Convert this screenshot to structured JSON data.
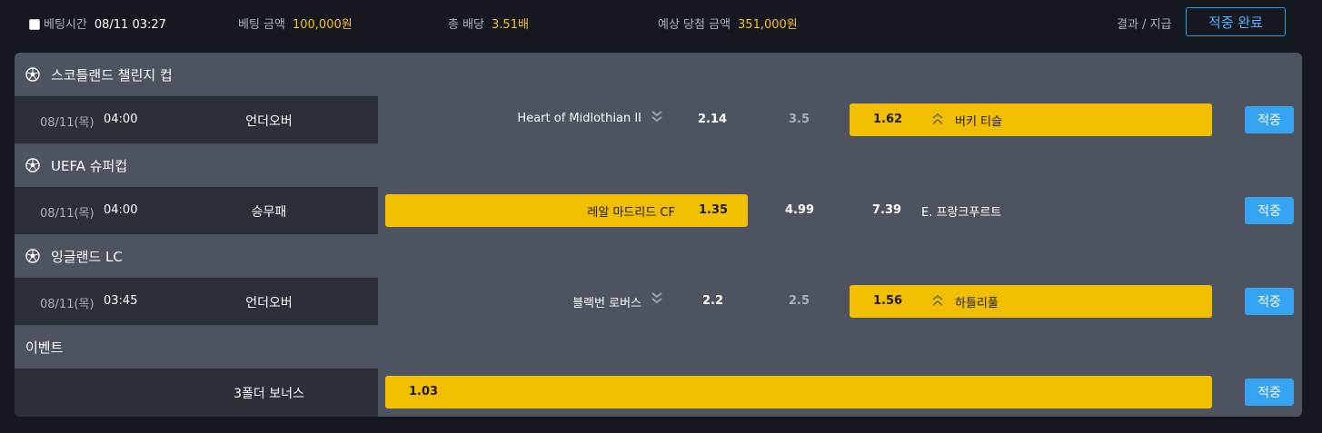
{
  "summary": {
    "bet_time_label": "베팅시간",
    "bet_time_value": "08/11 03:27",
    "bet_amount_label": "베팅 금액",
    "bet_amount_value": "100,000원",
    "total_odds_label": "총 배당",
    "total_odds_value": "3.51배",
    "expected_win_label": "예상 당첨 금액",
    "expected_win_value": "351,000원",
    "result_label": "결과 / 지급",
    "done_button": "적중 완료"
  },
  "colors": {
    "background": "#15181e",
    "panel": "#4e545f",
    "row_left": "#2b3038",
    "highlight": "#f2be00",
    "accent_blue": "#34a3f2",
    "value_yellow": "#f3c01a"
  },
  "icons": {
    "league": "soccer-ball-icon",
    "down": "double-chevron-down-icon",
    "up": "double-chevron-up-icon"
  },
  "leagues": [
    {
      "name": "스코틀랜드 챌린지 컵",
      "date": "08/11(목)",
      "time": "04:00",
      "market": "언더오버",
      "home": "Heart of Midlothian II",
      "home_odd": "2.14",
      "line": "3.5",
      "away_odd": "1.62",
      "away": "버키 티슬",
      "status": "적중"
    },
    {
      "name": "UEFA 슈퍼컵",
      "date": "08/11(목)",
      "time": "04:00",
      "market": "승무패",
      "home": "레알 마드리드 CF",
      "home_odd": "1.35",
      "draw_odd": "4.99",
      "away_odd": "7.39",
      "away": "E. 프랑크푸르트",
      "status": "적중"
    },
    {
      "name": "잉글랜드 LC",
      "date": "08/11(목)",
      "time": "03:45",
      "market": "언더오버",
      "home": "블랙번 로버스",
      "home_odd": "2.2",
      "line": "2.5",
      "away_odd": "1.56",
      "away": "하틀리풀",
      "status": "적중"
    }
  ],
  "event": {
    "name": "이벤트",
    "market": "3폴더 보너스",
    "odd": "1.03",
    "status": "적중"
  }
}
